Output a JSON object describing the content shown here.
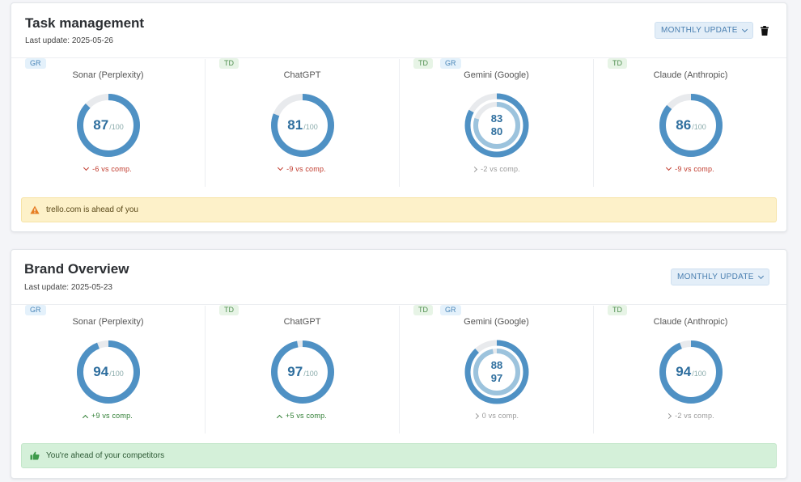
{
  "colors": {
    "ring_primary": "#4f91c4",
    "ring_secondary": "#9cc3dd",
    "ring_track": "#e8eaed",
    "score_text": "#2e6e9e",
    "warning_bg": "#fdf1c9",
    "success_bg": "#d4f0d9"
  },
  "cards": [
    {
      "title": "Task management",
      "last_update": "Last update: 2025-05-26",
      "button_label": "MONTHLY UPDATE",
      "has_delete": true,
      "models": [
        {
          "name": "Sonar (Perplexity)",
          "badges": [
            "GR"
          ],
          "scores": [
            87
          ],
          "max": "/100",
          "delta": "-6 vs comp.",
          "trend": "down"
        },
        {
          "name": "ChatGPT",
          "badges": [
            "TD"
          ],
          "scores": [
            81
          ],
          "max": "/100",
          "delta": "-9 vs comp.",
          "trend": "down"
        },
        {
          "name": "Gemini (Google)",
          "badges": [
            "TD",
            "GR"
          ],
          "scores": [
            83,
            80
          ],
          "max": "",
          "delta": "-2 vs comp.",
          "trend": "neutral"
        },
        {
          "name": "Claude (Anthropic)",
          "badges": [
            "TD"
          ],
          "scores": [
            86
          ],
          "max": "/100",
          "delta": "-9 vs comp.",
          "trend": "down"
        }
      ],
      "alert": {
        "type": "warning",
        "icon": "warning-icon",
        "text": "trello.com is ahead of you"
      }
    },
    {
      "title": "Brand Overview",
      "last_update": "Last update: 2025-05-23",
      "button_label": "MONTHLY UPDATE",
      "has_delete": false,
      "models": [
        {
          "name": "Sonar (Perplexity)",
          "badges": [
            "GR"
          ],
          "scores": [
            94
          ],
          "max": "/100",
          "delta": "+9 vs comp.",
          "trend": "up"
        },
        {
          "name": "ChatGPT",
          "badges": [
            "TD"
          ],
          "scores": [
            97
          ],
          "max": "/100",
          "delta": "+5 vs comp.",
          "trend": "up"
        },
        {
          "name": "Gemini (Google)",
          "badges": [
            "TD",
            "GR"
          ],
          "scores": [
            88,
            97
          ],
          "max": "",
          "delta": "0 vs comp.",
          "trend": "neutral"
        },
        {
          "name": "Claude (Anthropic)",
          "badges": [
            "TD"
          ],
          "scores": [
            94
          ],
          "max": "/100",
          "delta": "-2 vs comp.",
          "trend": "neutral"
        }
      ],
      "alert": {
        "type": "success",
        "icon": "thumbs-up-icon",
        "text": "You're ahead of your competitors"
      }
    }
  ]
}
